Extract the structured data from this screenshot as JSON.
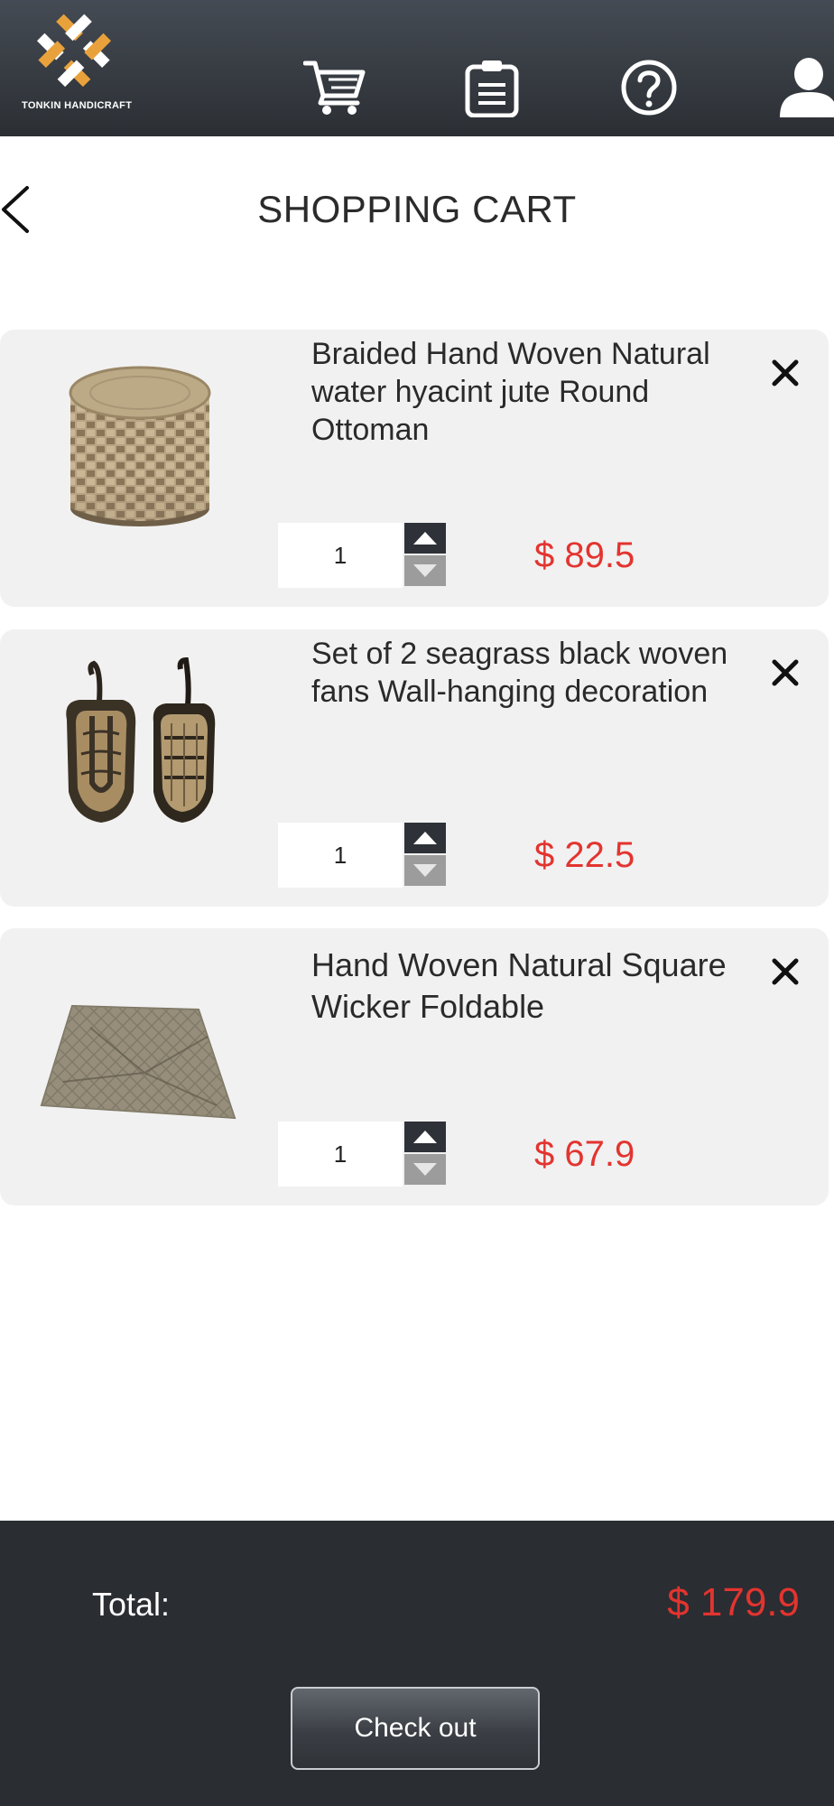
{
  "header": {
    "brand_name": "TONKIN HANDICRAFT",
    "nav": [
      {
        "name": "cart",
        "icon": "cart-icon"
      },
      {
        "name": "orders",
        "icon": "clipboard-icon"
      },
      {
        "name": "help",
        "icon": "help-circle-icon"
      },
      {
        "name": "account",
        "icon": "user-icon"
      }
    ]
  },
  "page": {
    "title": "SHOPPING CART",
    "back_icon": "chevron-left-icon"
  },
  "cart": {
    "items": [
      {
        "name": "Braided Hand Woven Natural water hyacint jute Round Ottoman",
        "quantity": "1",
        "price": "$ 89.5",
        "image": "round-ottoman-image"
      },
      {
        "name": "Set of 2 seagrass black woven fans Wall-hanging decoration",
        "quantity": "1",
        "price": "$ 22.5",
        "image": "woven-fans-image"
      },
      {
        "name": "Hand Woven Natural Square Wicker Foldable",
        "quantity": "1",
        "price": "$ 67.9",
        "image": "wicker-mat-image"
      }
    ],
    "remove_icon": "close-icon",
    "increment_icon": "triangle-up-icon",
    "decrement_icon": "triangle-down-icon"
  },
  "footer": {
    "total_label": "Total:",
    "total_value": "$ 179.9",
    "checkout_label": "Check out"
  },
  "colors": {
    "header_bg": "#2b2f34",
    "footer_bg": "#2a2d32",
    "price_red": "#e3342f",
    "brand_orange": "#e9a23b",
    "card_bg": "#f1f1f1"
  }
}
